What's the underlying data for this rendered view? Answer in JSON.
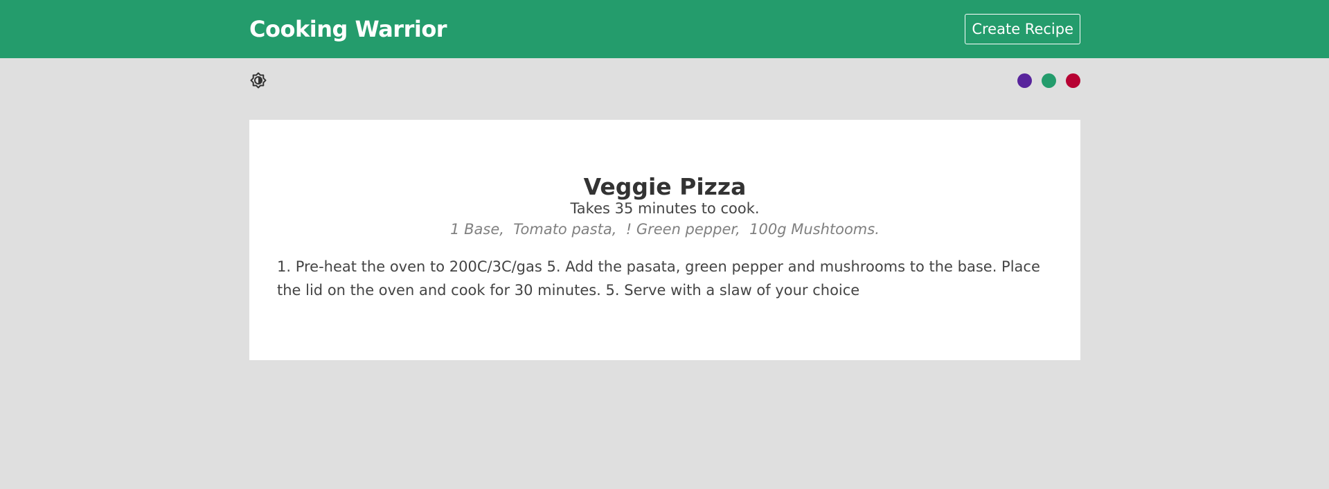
{
  "header": {
    "brand": "Cooking Warrior",
    "create_label": "Create Recipe",
    "background": "#249c6c"
  },
  "toolbar": {
    "theme_icon": "brightness-contrast-icon",
    "swatches": [
      {
        "name": "purple",
        "color": "#58249c"
      },
      {
        "name": "green",
        "color": "#249c6c"
      },
      {
        "name": "red",
        "color": "#b70233"
      }
    ]
  },
  "recipe": {
    "title": "Veggie Pizza",
    "cook_time": "Takes 35 minutes to cook.",
    "ingredients": "1 Base,  Tomato pasta,  ! Green pepper,  100g Mushtooms.",
    "method": "1. Pre-heat the oven to 200C/3C/gas 5. Add the pasata, green pepper and mushrooms to the base. Place the lid on the oven and cook for 30 minutes. 5. Serve with a slaw of your choice"
  }
}
